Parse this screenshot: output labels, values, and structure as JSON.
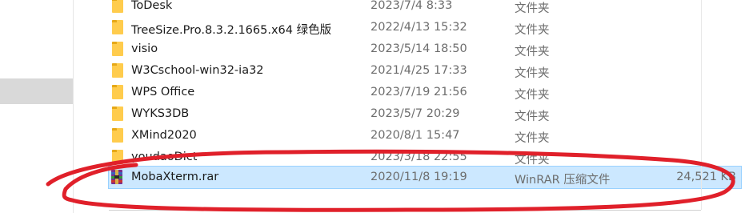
{
  "file_list": {
    "rows": [
      {
        "name": "ToDesk",
        "date": "2023/7/4 8:33",
        "type": "文件夹",
        "size": "",
        "icon": "folder-icon"
      },
      {
        "name": "TreeSize.Pro.8.3.2.1665.x64 绿色版",
        "date": "2022/4/13 15:32",
        "type": "文件夹",
        "size": "",
        "icon": "folder-icon"
      },
      {
        "name": "visio",
        "date": "2023/5/14 18:50",
        "type": "文件夹",
        "size": "",
        "icon": "folder-icon"
      },
      {
        "name": "W3Cschool-win32-ia32",
        "date": "2021/4/25 17:33",
        "type": "文件夹",
        "size": "",
        "icon": "folder-icon"
      },
      {
        "name": "WPS Office",
        "date": "2023/7/19 21:56",
        "type": "文件夹",
        "size": "",
        "icon": "folder-icon"
      },
      {
        "name": "WYKS3DB",
        "date": "2023/5/7 20:29",
        "type": "文件夹",
        "size": "",
        "icon": "folder-icon"
      },
      {
        "name": "XMind2020",
        "date": "2020/8/1 15:47",
        "type": "文件夹",
        "size": "",
        "icon": "folder-icon"
      },
      {
        "name": "youdaoDict",
        "date": "2023/3/18 22:55",
        "type": "文件夹",
        "size": "",
        "icon": "folder-icon"
      },
      {
        "name": "MobaXterm.rar",
        "date": "2020/11/8 19:19",
        "type": "WinRAR 压缩文件",
        "size": "24,521 KB",
        "icon": "winrar-archive-icon"
      }
    ]
  },
  "colors": {
    "selection": "#cce8ff",
    "annotation": "#e0202a",
    "folder": "#ffcc4d"
  }
}
